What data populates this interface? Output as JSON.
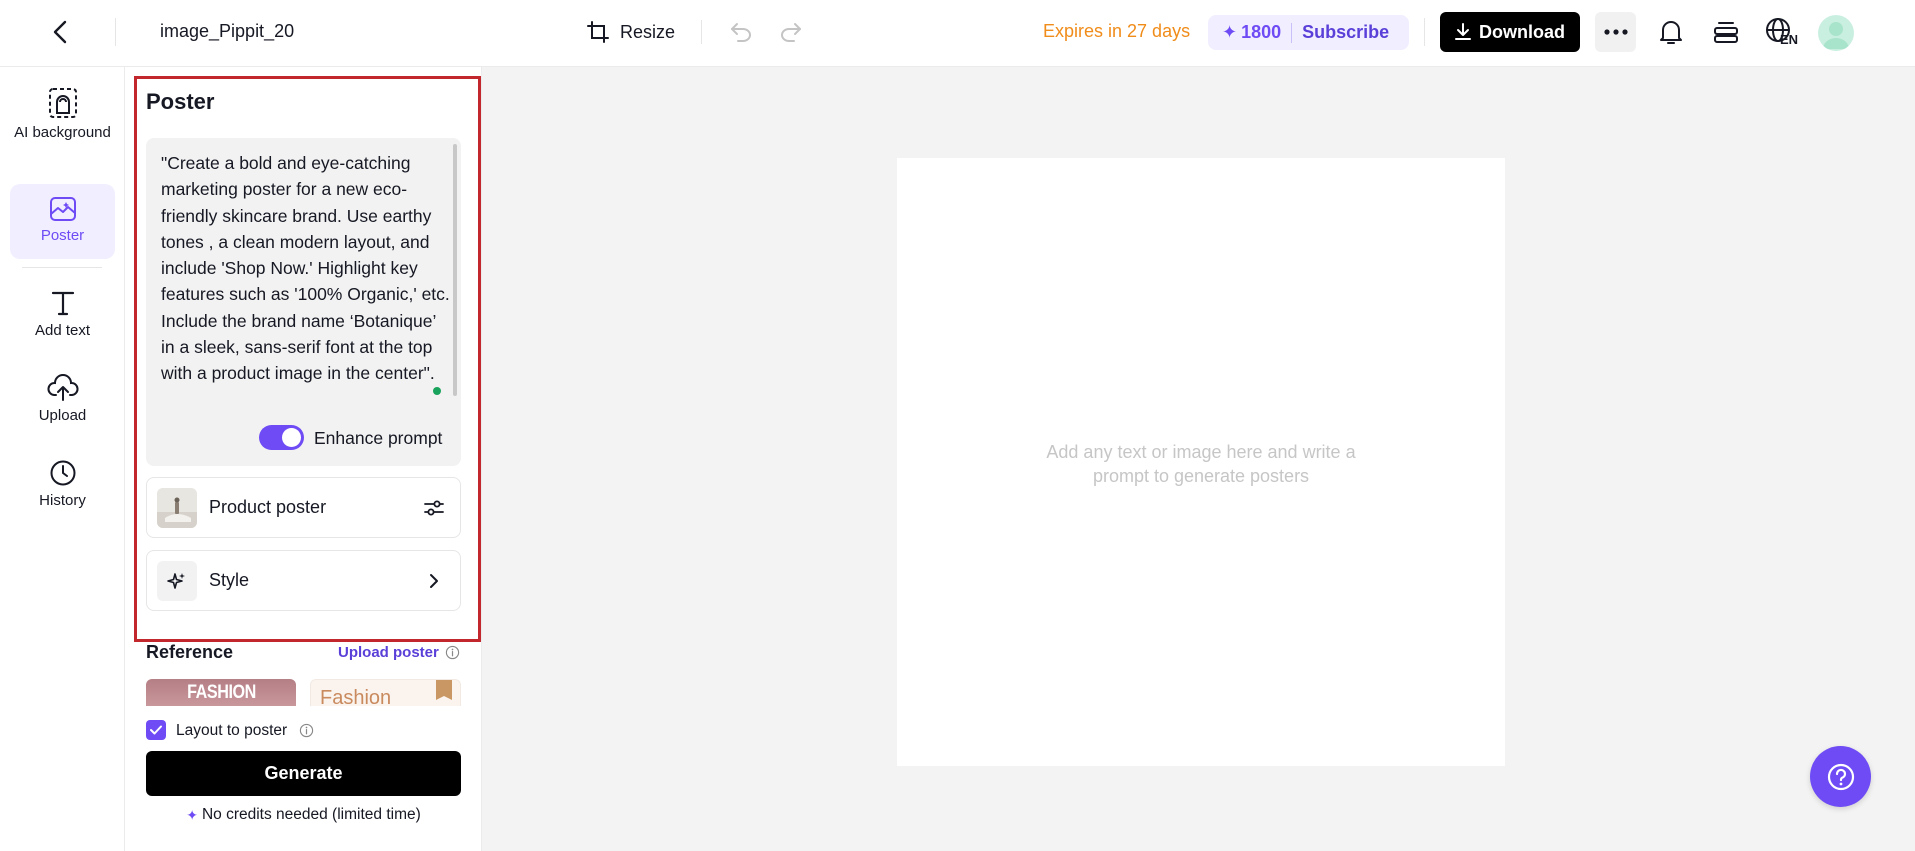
{
  "topbar": {
    "file_title": "image_Pippit_20",
    "resize_label": "Resize",
    "expires_text": "Expires in 27 days",
    "credits": "1800",
    "subscribe_label": "Subscribe",
    "download_label": "Download",
    "language_code": "EN"
  },
  "nav": {
    "items": [
      {
        "label": "AI background",
        "icon": "ai-background-icon"
      },
      {
        "label": "Poster",
        "icon": "poster-icon"
      },
      {
        "label": "Add text",
        "icon": "text-icon"
      },
      {
        "label": "Upload",
        "icon": "upload-icon"
      },
      {
        "label": "History",
        "icon": "history-icon"
      }
    ],
    "active": "Poster"
  },
  "panel": {
    "title": "Poster",
    "prompt": "\"Create a bold and eye-catching marketing poster for a new eco-friendly skincare brand. Use earthy tones , a clean modern layout, and include 'Shop Now.' Highlight key features such as '100% Organic,' etc. Include the brand name ‘Botanique’ in a sleek, sans-serif font at the top with a product image in the center\".",
    "enhance_prompt_label": "Enhance prompt",
    "enhance_prompt_on": true,
    "product_poster_label": "Product poster",
    "style_label": "Style",
    "reference_title": "Reference",
    "upload_poster_label": "Upload poster",
    "reference_1_text": "FASHION",
    "reference_2_text": "Fashion",
    "layout_to_poster_label": "Layout to poster",
    "layout_to_poster_checked": true,
    "generate_label": "Generate",
    "no_credits_text": "No credits needed (limited time)"
  },
  "canvas": {
    "hint": "Add any text or image here and write a prompt to generate posters"
  },
  "colors": {
    "accent": "#6e4bf5",
    "expires": "#f08c1a",
    "highlight_border": "#c1272d"
  }
}
